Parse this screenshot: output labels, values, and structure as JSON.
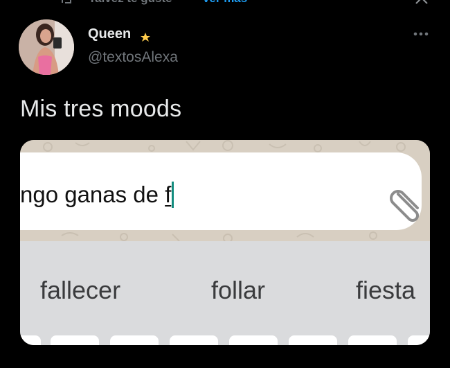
{
  "topbar": {
    "suggestion_label": "Talvez te guste",
    "more_label": "Ver más"
  },
  "tweet": {
    "author_name": "Queen",
    "author_handle": "@textosAlexa",
    "text": "Mis tres moods",
    "badge_icon": "crescent-moon-star-icon"
  },
  "media": {
    "typed_text_prefix": "ngo ganas de ",
    "typed_text_last": "f",
    "attach_icon": "paperclip-icon",
    "suggestions": [
      "fallecer",
      "follar",
      "fiesta"
    ]
  },
  "colors": {
    "background": "#000000",
    "text": "#e7e9ea",
    "secondary": "#71767b",
    "link": "#1d9bf0",
    "caret": "#128c7e"
  }
}
